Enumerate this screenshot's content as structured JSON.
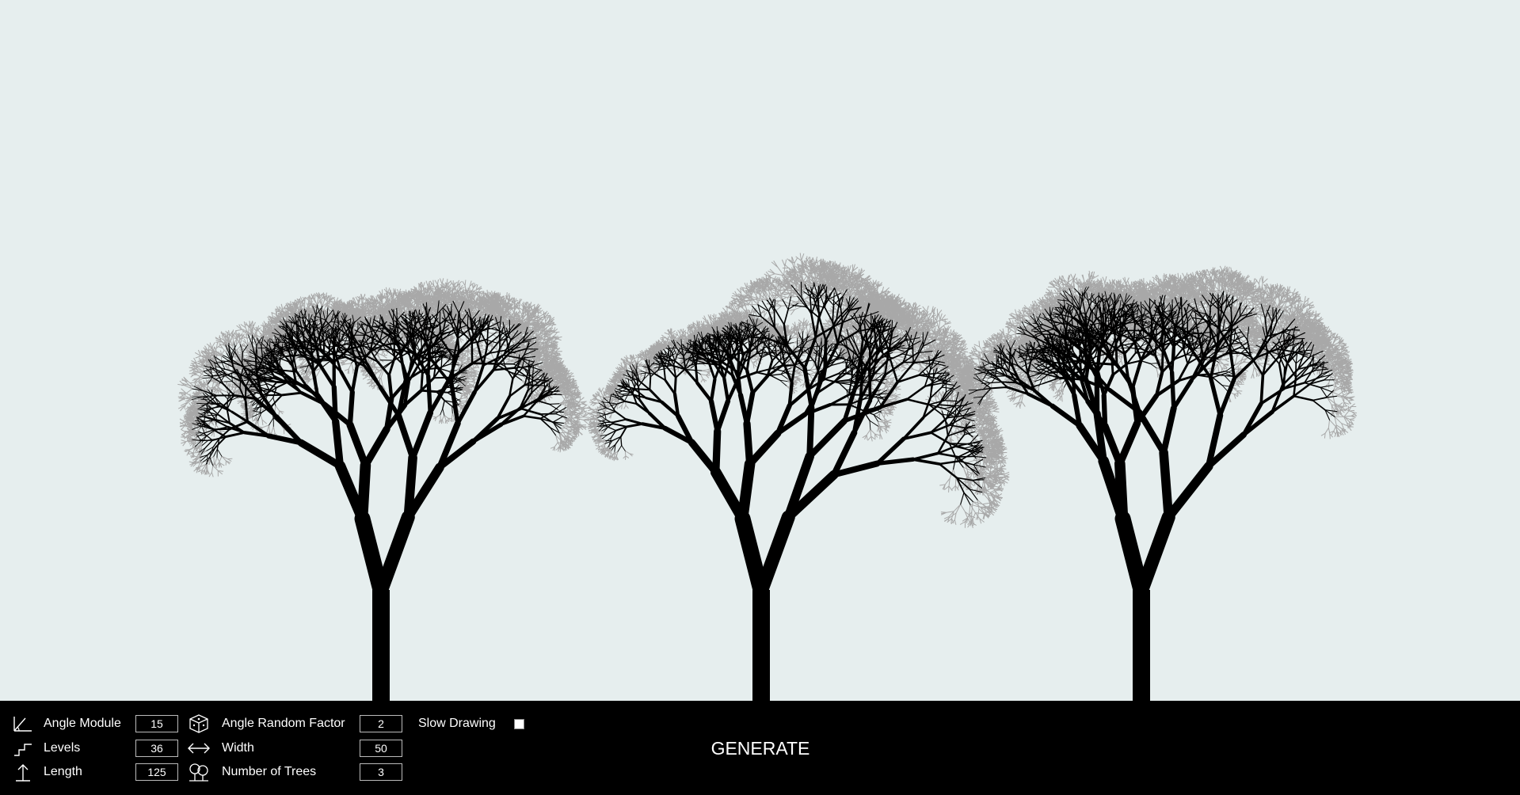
{
  "controls": {
    "angle_module": {
      "label": "Angle Module",
      "value": "15",
      "icon": "angle-icon"
    },
    "levels": {
      "label": "Levels",
      "value": "36",
      "icon": "stairs-icon"
    },
    "length": {
      "label": "Length",
      "value": "125",
      "icon": "arrow-up-icon"
    },
    "angle_random_factor": {
      "label": "Angle Random Factor",
      "value": "2",
      "icon": "dice-icon"
    },
    "width": {
      "label": "Width",
      "value": "50",
      "icon": "double-arrow-icon"
    },
    "number_of_trees": {
      "label": "Number of Trees",
      "value": "3",
      "icon": "trees-icon"
    },
    "slow_drawing": {
      "label": "Slow Drawing",
      "checked": false
    }
  },
  "generate_label": "GENERATE",
  "colors": {
    "background": "#e6eeee",
    "trunk": "#000000",
    "foliage": "#a8a8a8",
    "control_bar": "#000000"
  }
}
